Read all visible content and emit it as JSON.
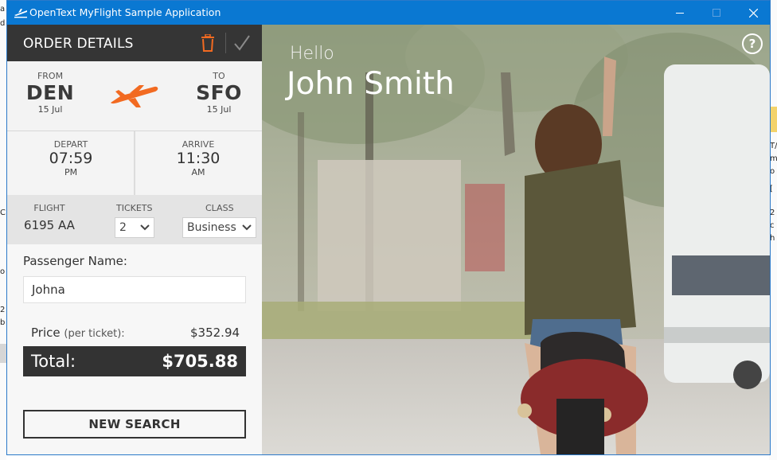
{
  "window": {
    "title": "OpenText MyFlight Sample Application",
    "controls": {
      "minimize": "—",
      "maximize": "☐",
      "close": "✕"
    },
    "titlebar_color": "#0a78d2"
  },
  "order": {
    "header": "ORDER DETAILS",
    "from": {
      "label": "FROM",
      "code": "DEN",
      "date": "15 Jul"
    },
    "to": {
      "label": "TO",
      "code": "SFO",
      "date": "15 Jul"
    },
    "depart": {
      "label": "DEPART",
      "time": "07:59",
      "ampm": "PM"
    },
    "arrive": {
      "label": "ARRIVE",
      "time": "11:30",
      "ampm": "AM"
    },
    "flight": {
      "label": "FLIGHT",
      "value": "6195 AA"
    },
    "tickets": {
      "label": "TICKETS",
      "value": "2"
    },
    "class": {
      "label": "CLASS",
      "value": "Business"
    },
    "passenger": {
      "label": "Passenger Name:",
      "value": "Johna"
    },
    "price": {
      "label": "Price",
      "per": "(per ticket):",
      "value": "$352.94"
    },
    "total": {
      "label": "Total:",
      "value": "$705.88"
    },
    "new_search": "NEW SEARCH",
    "accent_color": "#f26a21",
    "icons": [
      "trash-icon",
      "check-icon",
      "airplane-icon",
      "chevron-down-icon"
    ]
  },
  "hero": {
    "greeting": "Hello",
    "user_name": "John Smith",
    "help": "?"
  }
}
